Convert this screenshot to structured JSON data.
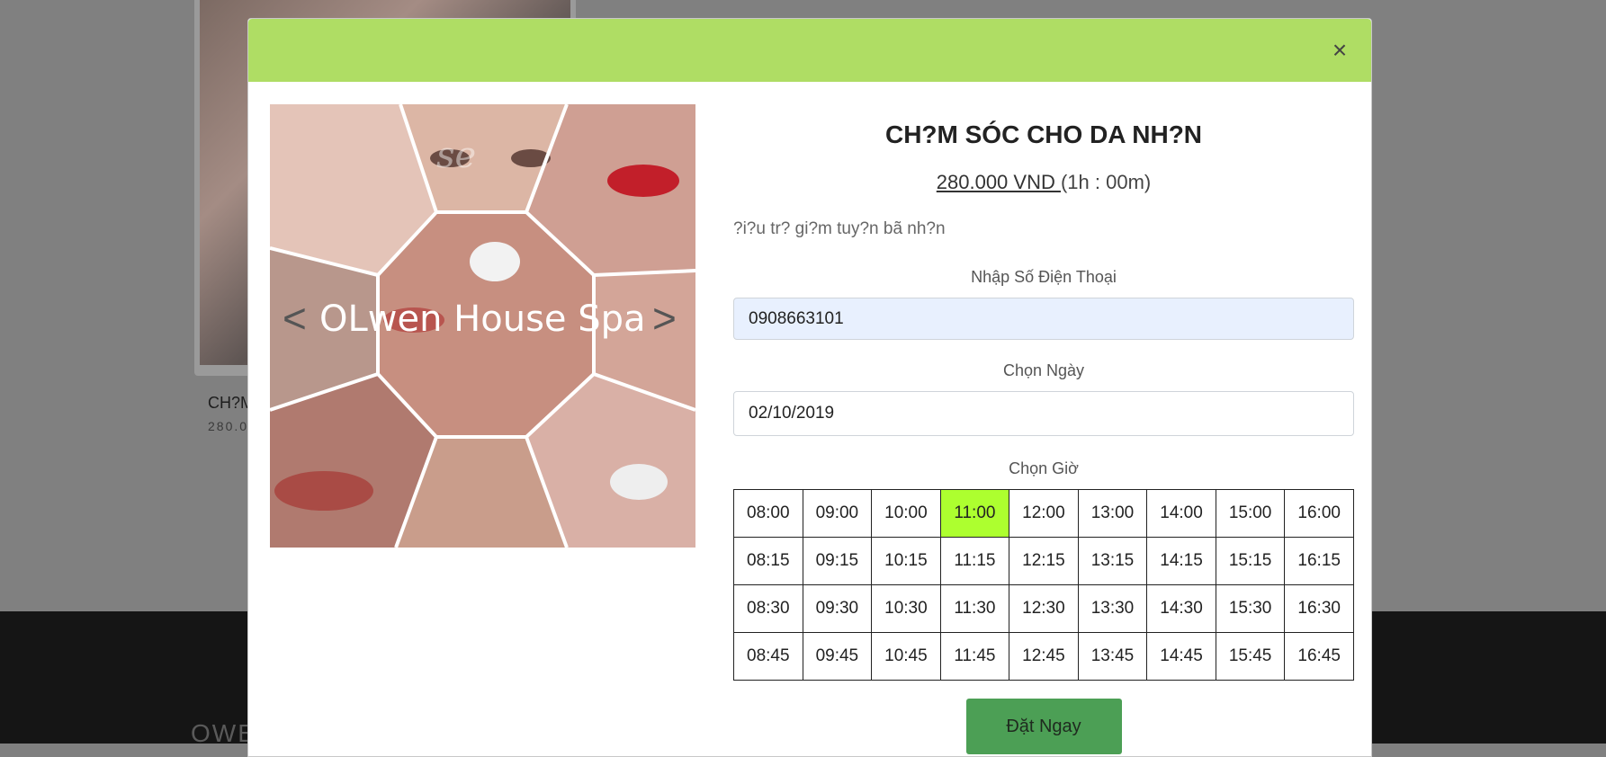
{
  "background": {
    "card_title": "CH?M",
    "card_price": "280.0",
    "footer_text": "OWE"
  },
  "modal": {
    "close_label": "×",
    "hero": {
      "overlay_text": "OLwen House Spa",
      "prev_arrow": "<",
      "next_arrow": ">",
      "watermark": "se"
    },
    "title": "CH?M SÓC CHO DA NH?N",
    "price": "280.000 VND ",
    "duration": "(1h : 00m)",
    "description": "?i?u tr? gi?m tuy?n bã nh?n",
    "phone": {
      "label": "Nhập Số Điện Thoại",
      "value": "0908663101"
    },
    "date": {
      "label": "Chọn Ngày",
      "value": "02/10/2019"
    },
    "time": {
      "label": "Chọn Giờ",
      "selected": "11:00",
      "rows": [
        [
          "08:00",
          "09:00",
          "10:00",
          "11:00",
          "12:00",
          "13:00",
          "14:00",
          "15:00",
          "16:00"
        ],
        [
          "08:15",
          "09:15",
          "10:15",
          "11:15",
          "12:15",
          "13:15",
          "14:15",
          "15:15",
          "16:15"
        ],
        [
          "08:30",
          "09:30",
          "10:30",
          "11:30",
          "12:30",
          "13:30",
          "14:30",
          "15:30",
          "16:30"
        ],
        [
          "08:45",
          "09:45",
          "10:45",
          "11:45",
          "12:45",
          "13:45",
          "14:45",
          "15:45",
          "16:45"
        ]
      ]
    },
    "submit_label": "Đặt Ngay"
  },
  "colors": {
    "header": "#afdd64",
    "selected_slot": "#adff2f",
    "button": "#4c9f55"
  }
}
